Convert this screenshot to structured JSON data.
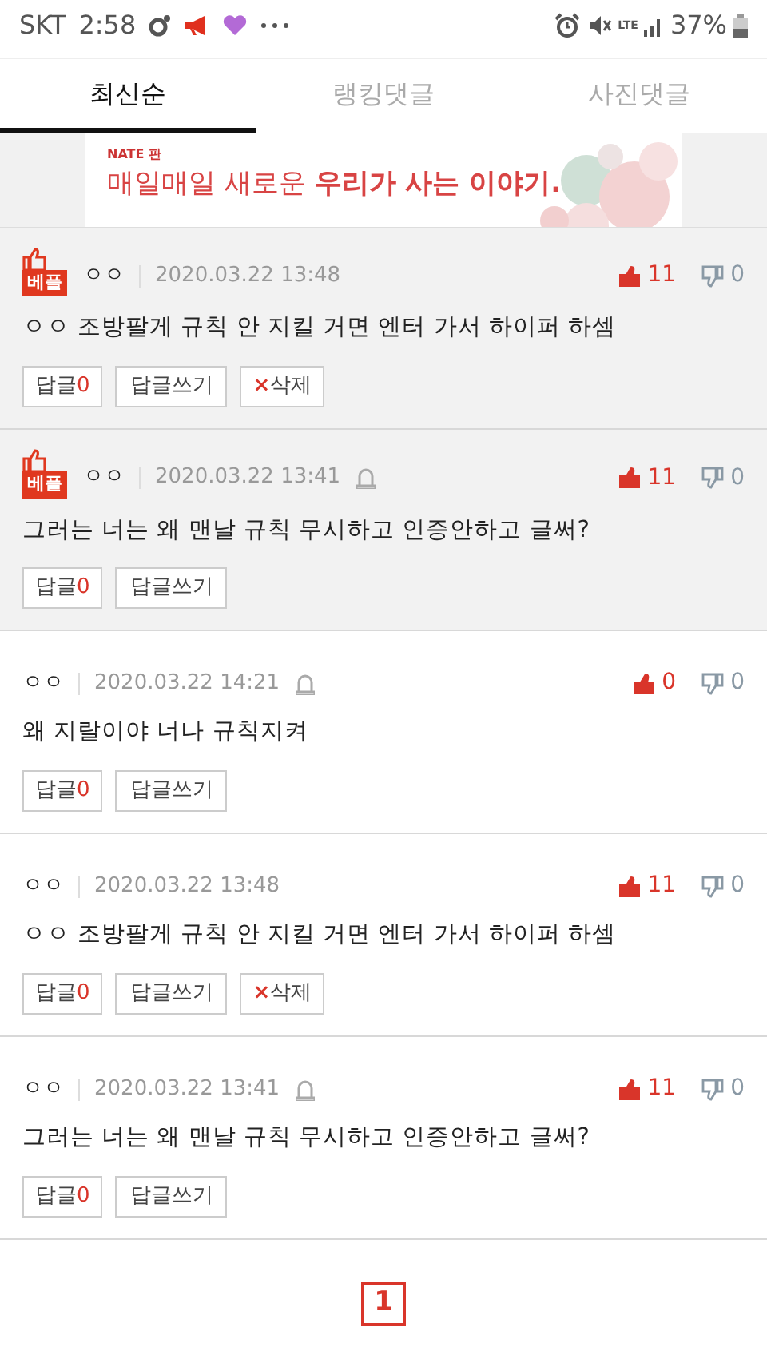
{
  "status_bar": {
    "carrier": "SKT",
    "time": "2:58",
    "battery": "37%",
    "network": "LTE"
  },
  "tabs": [
    {
      "label": "최신순",
      "selected": true
    },
    {
      "label": "랭킹댓글",
      "selected": false
    },
    {
      "label": "사진댓글",
      "selected": false
    }
  ],
  "banner": {
    "brand": "NATE 판",
    "headline": "매일매일 새로운 **우리가 사는 이야기.**"
  },
  "comments": [
    {
      "best": true,
      "best_label": "베플",
      "author": "ㅇㅇ",
      "date": "2020.03.22 13:48",
      "reported": false,
      "likes": "11",
      "dislikes": "0",
      "text": "ㅇㅇ 조방팔게 규칙 안 지킬 거면 엔터 가서 하이퍼 하셈",
      "reply_label": "답글",
      "reply_count": "0",
      "write_label": "답글쓰기",
      "can_delete": true,
      "delete_label": "삭제",
      "delete_mark": "×"
    },
    {
      "best": true,
      "best_label": "베플",
      "author": "ㅇㅇ",
      "date": "2020.03.22 13:41",
      "reported": true,
      "likes": "11",
      "dislikes": "0",
      "text": "그러는 너는 왜 맨날 규칙 무시하고 인증안하고 글써?",
      "reply_label": "답글",
      "reply_count": "0",
      "write_label": "답글쓰기",
      "can_delete": false
    },
    {
      "best": false,
      "author": "ㅇㅇ",
      "date": "2020.03.22 14:21",
      "reported": true,
      "likes": "0",
      "dislikes": "0",
      "text": "왜 지랄이야 너나 규칙지켜",
      "reply_label": "답글",
      "reply_count": "0",
      "write_label": "답글쓰기",
      "can_delete": false
    },
    {
      "best": false,
      "author": "ㅇㅇ",
      "date": "2020.03.22 13:48",
      "reported": false,
      "likes": "11",
      "dislikes": "0",
      "text": "ㅇㅇ 조방팔게 규칙 안 지킬 거면 엔터 가서 하이퍼 하셈",
      "reply_label": "답글",
      "reply_count": "0",
      "write_label": "답글쓰기",
      "can_delete": true,
      "delete_label": "삭제",
      "delete_mark": "×"
    },
    {
      "best": false,
      "author": "ㅇㅇ",
      "date": "2020.03.22 13:41",
      "reported": true,
      "likes": "11",
      "dislikes": "0",
      "text": "그러는 너는 왜 맨날 규칙 무시하고 인증안하고 글써?",
      "reply_label": "답글",
      "reply_count": "0",
      "write_label": "답글쓰기",
      "can_delete": false
    }
  ],
  "pagination": [
    {
      "label": "1",
      "selected": true
    }
  ]
}
